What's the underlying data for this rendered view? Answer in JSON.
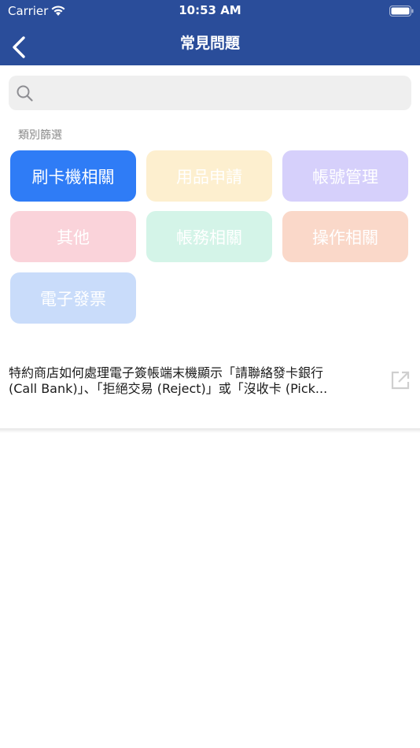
{
  "status_bar": {
    "carrier": "Carrier",
    "time": "10:53 AM"
  },
  "nav": {
    "title": "常見問題"
  },
  "search": {
    "placeholder": ""
  },
  "filter": {
    "label": "類別篩選",
    "chips": [
      {
        "label": "刷卡機相關",
        "color": "#2f7cf6",
        "selected": true
      },
      {
        "label": "用品申請",
        "color": "#fdefcf",
        "selected": false
      },
      {
        "label": "帳號管理",
        "color": "#d6d0fb",
        "selected": false
      },
      {
        "label": "其他",
        "color": "#fad3da",
        "selected": false
      },
      {
        "label": "帳務相關",
        "color": "#d4f4e8",
        "selected": false
      },
      {
        "label": "操作相關",
        "color": "#fad8c9",
        "selected": false
      },
      {
        "label": "電子發票",
        "color": "#c9dcfa",
        "selected": false
      }
    ]
  },
  "faqs": [
    {
      "line1": "特約商店如何處理電子簽帳端末機顯示「請聯絡發卡銀行",
      "line2": "(Call Bank)」、「拒絕交易 (Reject)」或「沒收卡 (Pick..."
    }
  ]
}
